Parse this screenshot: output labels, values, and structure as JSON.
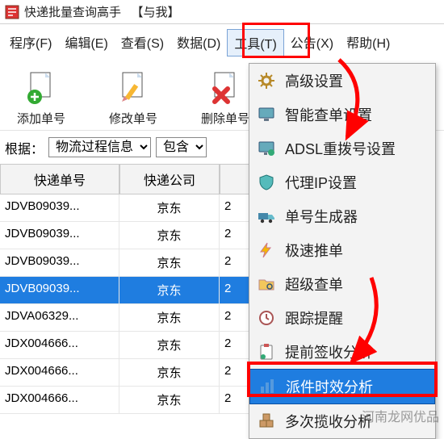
{
  "window": {
    "title": "快递批量查询高手",
    "title_suffix": "【与我】"
  },
  "menubar": {
    "items": [
      {
        "label": "程序(F)"
      },
      {
        "label": "编辑(E)"
      },
      {
        "label": "查看(S)"
      },
      {
        "label": "数据(D)"
      },
      {
        "label": "工具(T)",
        "open": true
      },
      {
        "label": "公告(X)"
      },
      {
        "label": "帮助(H)"
      }
    ]
  },
  "toolbar": {
    "buttons": [
      {
        "label": "添加单号",
        "icon": "add-doc"
      },
      {
        "label": "修改单号",
        "icon": "edit-doc"
      },
      {
        "label": "删除单号",
        "icon": "delete-doc"
      }
    ]
  },
  "filter": {
    "root_label": "根据：",
    "field": "物流过程信息",
    "op": "包含"
  },
  "grid": {
    "columns": [
      "快递单号",
      "快递公司"
    ],
    "rows": [
      {
        "no": "JDVB09039...",
        "co": "京东",
        "ext": "2",
        "selected": false
      },
      {
        "no": "JDVB09039...",
        "co": "京东",
        "ext": "2",
        "selected": false
      },
      {
        "no": "JDVB09039...",
        "co": "京东",
        "ext": "2",
        "selected": false
      },
      {
        "no": "JDVB09039...",
        "co": "京东",
        "ext": "2",
        "selected": true
      },
      {
        "no": "JDVA06329...",
        "co": "京东",
        "ext": "2",
        "selected": false
      },
      {
        "no": "JDX004666...",
        "co": "京东",
        "ext": "2",
        "selected": false
      },
      {
        "no": "JDX004666...",
        "co": "京东",
        "ext": "2",
        "selected": false
      },
      {
        "no": "JDX004666...",
        "co": "京东",
        "ext": "2",
        "selected": false
      }
    ]
  },
  "tools_menu": {
    "items": [
      {
        "label": "高级设置",
        "icon": "gear"
      },
      {
        "label": "智能查单设置",
        "icon": "monitor"
      },
      {
        "label": "ADSL重拨号设置",
        "icon": "monitor-net"
      },
      {
        "label": "代理IP设置",
        "icon": "shield"
      },
      {
        "label": "单号生成器",
        "icon": "truck"
      },
      {
        "label": "极速推单",
        "icon": "bolt"
      },
      {
        "label": "超级查单",
        "icon": "folder-search"
      },
      {
        "label": "跟踪提醒",
        "icon": "clock"
      },
      {
        "label": "提前签收分析",
        "icon": "clipboard"
      },
      {
        "label": "派件时效分析",
        "icon": "bar-chart",
        "selected": true
      },
      {
        "label": "多次揽收分析",
        "icon": "boxes"
      }
    ]
  },
  "watermark": "河南龙网优品"
}
